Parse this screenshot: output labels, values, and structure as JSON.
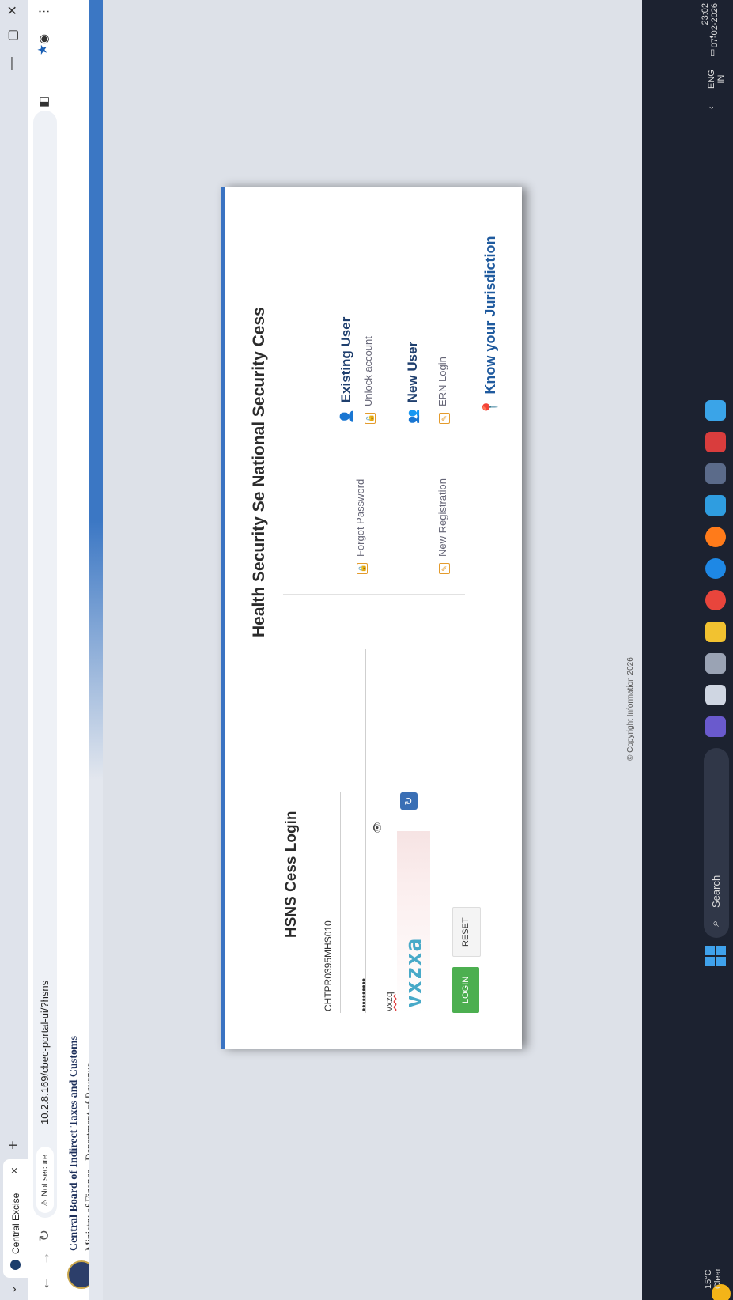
{
  "browser": {
    "tab_title": "Central Excise",
    "tab_close": "×",
    "new_tab": "+",
    "not_secure": "⚠ Not secure",
    "url": "10.2.8.169/cbec-portal-ui/?hsns"
  },
  "header": {
    "org_name": "Central Board of Indirect Taxes and Customs",
    "org_sub": "Ministry of Finance - Department of Revenue"
  },
  "card": {
    "title": "Health Security Se National Security Cess",
    "login_title": "HSNS Cess Login",
    "username_value": "CHTPR0395MHS010",
    "password_value": "••••••••••",
    "captcha_input_value": "vxzq",
    "captcha_text": "vxzxa",
    "login_button": "LOGIN",
    "reset_button": "RESET",
    "existing_user": "Existing User",
    "forgot_password": "Forgot Password",
    "unlock_account": "Unlock account",
    "new_user": "New User",
    "new_registration": "New Registration",
    "ern_login": "ERN Login",
    "know_jurisdiction": "Know your Jurisdiction"
  },
  "footer": {
    "copyright": "© Copyright Information 2026"
  },
  "taskbar": {
    "weather_temp": "15°C",
    "weather_desc": "Clear",
    "search_placeholder": "Search",
    "lang_top": "ENG",
    "lang_bottom": "IN",
    "time": "23:02",
    "date": "07-02-2026"
  },
  "colors": {
    "accent_blue": "#3a73c2",
    "login_green": "#4caf50",
    "taskbar": "#1c2230"
  }
}
